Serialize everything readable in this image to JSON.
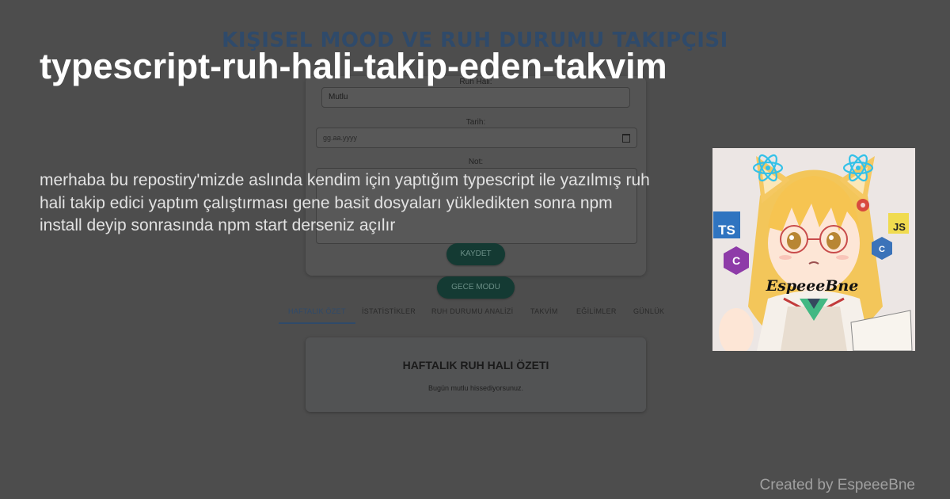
{
  "app": {
    "title": "KIŞISEL MOOD VE RUH DURUMU TAKIPÇISI",
    "form": {
      "mood_label": "Ruh Hali:",
      "mood_value": "Mutlu",
      "date_label": "Tarih:",
      "date_placeholder": "gg.aa.yyyy",
      "note_label": "Not:",
      "save_button": "KAYDET"
    },
    "night_mode_button": "GECE MODU",
    "tabs": [
      "HAFTALIK ÖZET",
      "İSTATİSTİKLER",
      "RUH DURUMU ANALİZİ",
      "TAKVİM",
      "EĞİLİMLER",
      "GÜNLÜK"
    ],
    "active_tab": "HAFTALIK ÖZET",
    "summary": {
      "title": "HAFTALIK RUH HALI ÖZETI",
      "text": "Bugün mutlu hissediyorsunuz."
    }
  },
  "repo": {
    "name": "typescript-ruh-hali-takip-eden-takvim",
    "description": "merhaba bu repostiry'mizde aslında kendim için yaptığım typescript ile yazılmış ruh hali takip edici yaptım çalıştırması gene basit dosyaları yükledikten sonra npm install deyip sonrasında npm start derseniz açılır",
    "credit": "Created by EspeeeBne"
  },
  "avatar": {
    "signature": "EspeeeBne",
    "badges": {
      "ts": "TS",
      "js": "JS"
    },
    "icons": [
      "react-icon",
      "react-icon",
      "typescript-icon",
      "javascript-icon",
      "csharp-icon",
      "cpp-icon",
      "vue-icon",
      "flower-icon"
    ]
  },
  "colors": {
    "background": "#4b4b4b",
    "title_text": "#ffffff",
    "description_text": "#e2e2e2",
    "credit_text": "#a0a0a0",
    "ts_blue": "#2f74c0",
    "js_yellow": "#f0db4f",
    "button_dark": "#143a33"
  }
}
